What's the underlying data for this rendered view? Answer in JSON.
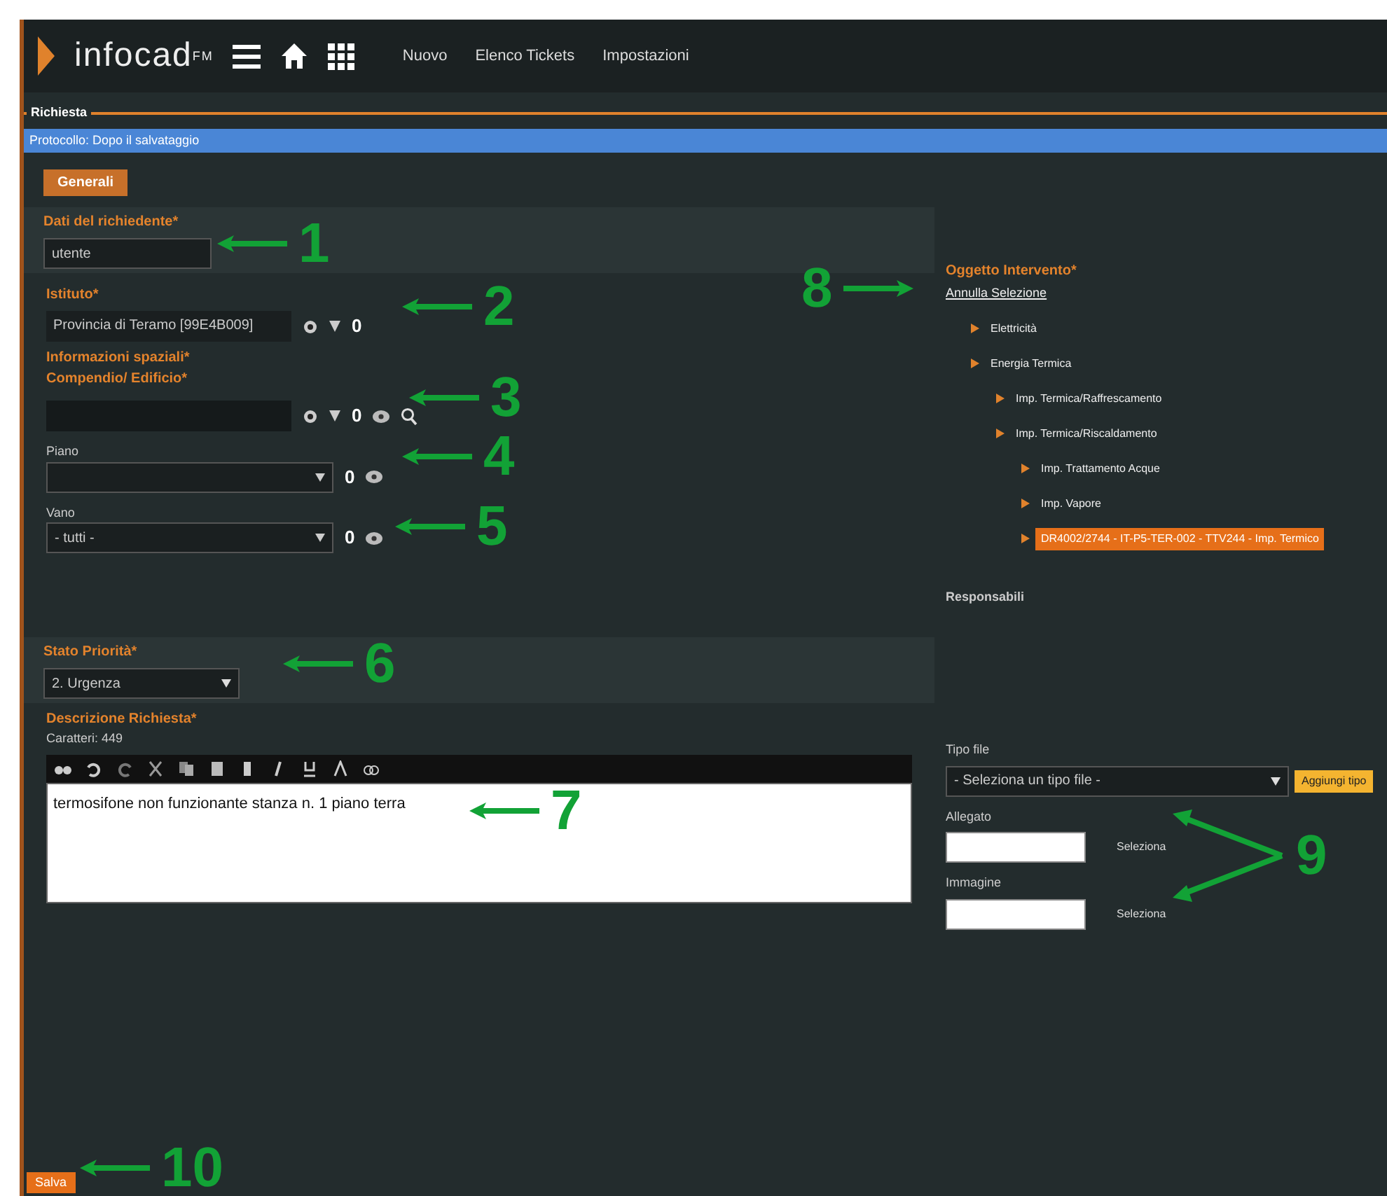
{
  "header": {
    "logo": "infocad",
    "logo_sup": "FM",
    "nav": [
      "Nuovo",
      "Elenco Tickets",
      "Impostazioni"
    ]
  },
  "section_title": "Richiesta",
  "protocol": "Protocollo: Dopo il salvataggio",
  "tabs": [
    {
      "label": "Generali",
      "selected": true
    }
  ],
  "left": {
    "requester": {
      "label": "Dati del richiedente*",
      "value": "utente"
    },
    "institute": {
      "label": "Istituto*",
      "value": "Provincia di Teramo [99E4B009]",
      "count": "0"
    },
    "spatial_label": "Informazioni spaziali*",
    "building": {
      "label": "Compendio/ Edificio*",
      "count": "0"
    },
    "floor": {
      "label": "Piano",
      "count": "0"
    },
    "room": {
      "label": "Vano",
      "value": "- tutti -",
      "count": "0"
    },
    "priority": {
      "label": "Stato Priorità*",
      "value": "2. Urgenza"
    },
    "description": {
      "label": "Descrizione Richiesta*",
      "counter": "Caratteri: 449",
      "text": "termosifone non funzionante stanza n. 1 piano terra"
    }
  },
  "right": {
    "object_label": "Oggetto Intervento*",
    "clear_link": "Annulla Selezione",
    "tree": [
      {
        "label": "Elettricità",
        "selected": false
      },
      {
        "label": "Energia Termica",
        "selected": false,
        "children": [
          {
            "label": "Imp. Termica/Raffrescamento",
            "selected": false
          },
          {
            "label": "Imp. Termica/Riscaldamento",
            "selected": false,
            "children": [
              {
                "label": "Imp. Trattamento Acque",
                "selected": false
              },
              {
                "label": "Imp. Vapore",
                "selected": false
              },
              {
                "label": "DR4002/2744 - IT-P5-TER-002 - TTV244 - Imp. Termico",
                "selected": true
              }
            ]
          }
        ]
      }
    ],
    "responsible_label": "Responsabili",
    "file_type": {
      "label": "Tipo file",
      "value": "- Seleziona un tipo file -",
      "add_button": "Aggiungi tipo"
    },
    "uploads": [
      {
        "label": "Allegato",
        "button": "Seleziona"
      },
      {
        "label": "Immagine",
        "button": "Seleziona"
      }
    ]
  },
  "save_button": "Salva",
  "annotations": [
    "1",
    "2",
    "3",
    "4",
    "5",
    "6",
    "7",
    "8",
    "9",
    "10"
  ]
}
